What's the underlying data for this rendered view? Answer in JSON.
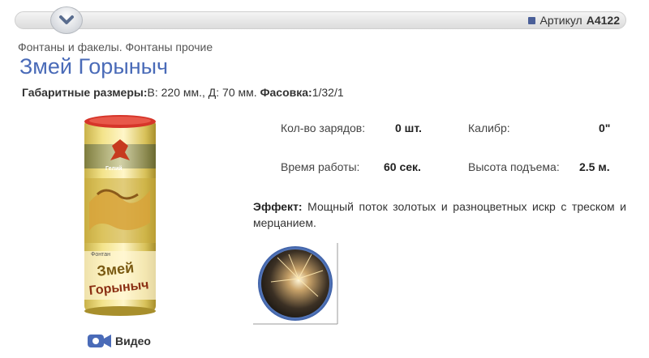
{
  "header": {
    "article_label": "Артикул",
    "article_code": "A4122"
  },
  "breadcrumb": "Фонтаны и факелы. Фонтаны прочие",
  "product": {
    "title": "Змей Горыныч",
    "dims_label": "Габаритные размеры:",
    "dims_value": "В: 220 мм., Д: 70 мм.",
    "pack_label": "Фасовка:",
    "pack_value": "1/32/1",
    "package_text_1": "Змей",
    "package_text_2": "Горыныч",
    "package_brand": "Фонтан"
  },
  "stats": {
    "charges_label": "Кол-во зарядов:",
    "charges_value": "0 шт.",
    "caliber_label": "Калибр:",
    "caliber_value": "0\"",
    "duration_label": "Время работы:",
    "duration_value": "60 сек.",
    "height_label": "Высота подъема:",
    "height_value": "2.5 м."
  },
  "effect": {
    "label": "Эффект:",
    "text": "Мощный поток золотых и разноцветных искр с треском и мерцанием."
  },
  "video": {
    "label": "Видео"
  },
  "colors": {
    "title": "#4a6bb8",
    "accent_square": "#4a5f98"
  },
  "icons": [
    "chevron-down-icon",
    "video-camera-icon"
  ]
}
